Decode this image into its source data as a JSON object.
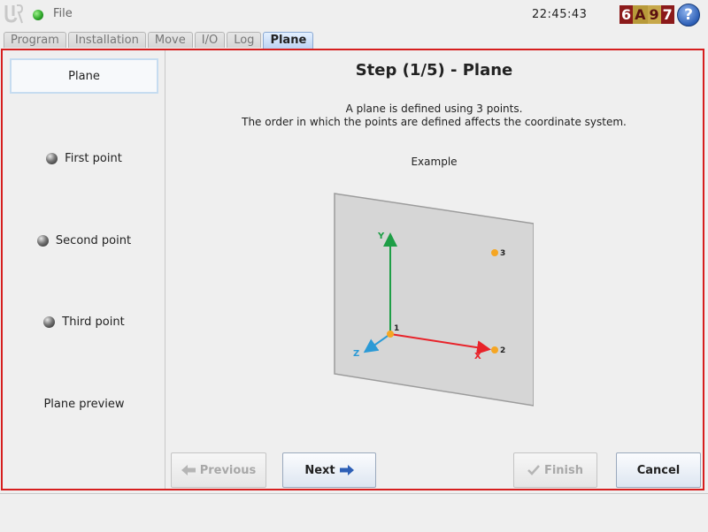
{
  "topbar": {
    "file_label": "File",
    "clock": "22:45:43",
    "serial": [
      "6",
      "A",
      "9",
      "7"
    ],
    "help_label": "?"
  },
  "tabs": [
    {
      "label": "Program",
      "active": false
    },
    {
      "label": "Installation",
      "active": false
    },
    {
      "label": "Move",
      "active": false
    },
    {
      "label": "I/O",
      "active": false
    },
    {
      "label": "Log",
      "active": false
    },
    {
      "label": "Plane",
      "active": true
    }
  ],
  "steps": [
    {
      "label": "Plane",
      "active": true,
      "icon": "none"
    },
    {
      "label": "First point",
      "active": false,
      "icon": "ball-icon"
    },
    {
      "label": "Second point",
      "active": false,
      "icon": "ball-icon"
    },
    {
      "label": "Third point",
      "active": false,
      "icon": "ball-icon"
    },
    {
      "label": "Plane preview",
      "active": false,
      "icon": "none"
    }
  ],
  "main": {
    "title": "Step (1/5) - Plane",
    "description_line1": "A plane is defined using 3 points.",
    "description_line2": "The order in which the points are defined affects the coordinate system.",
    "example_label": "Example"
  },
  "diagram": {
    "axis_labels": {
      "x": "X",
      "y": "Y",
      "z": "Z"
    },
    "point_labels": [
      "1",
      "2",
      "3"
    ],
    "colors": {
      "x_axis": "#e8232a",
      "y_axis": "#1e9e46",
      "z_axis": "#2b9ad6",
      "points": "#f5a623",
      "plane": "#d6d6d6"
    }
  },
  "buttons": {
    "previous": "Previous",
    "next": "Next",
    "finish": "Finish",
    "cancel": "Cancel"
  },
  "colors": {
    "frame_border": "#d61e1e",
    "active_tab": "#bcd3f3"
  }
}
